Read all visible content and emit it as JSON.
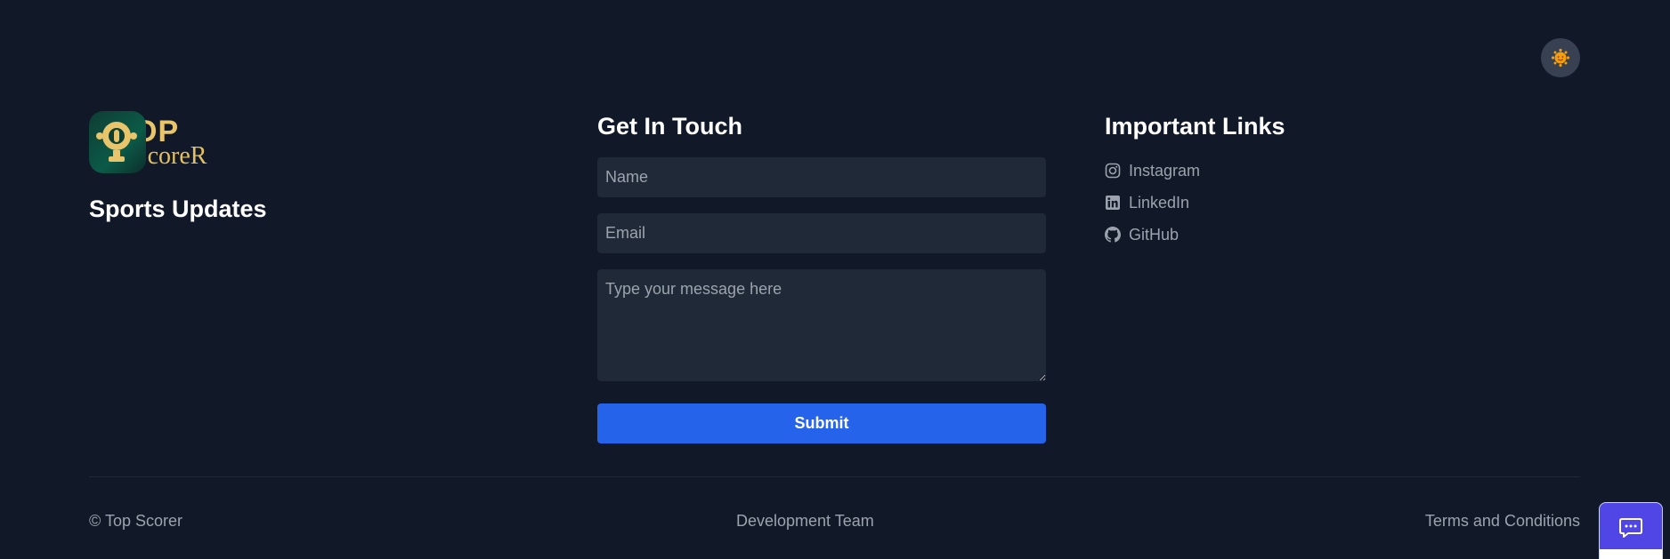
{
  "brand": {
    "logo_text_top": "OP",
    "logo_text_bottom": "ScoreR",
    "tagline": "Sports Updates"
  },
  "theme_toggle": {
    "icon": "sun-emoji-icon"
  },
  "contact": {
    "title": "Get In Touch",
    "name_placeholder": "Name",
    "email_placeholder": "Email",
    "message_placeholder": "Type your message here",
    "submit_label": "Submit"
  },
  "links": {
    "title": "Important Links",
    "items": [
      {
        "label": "Instagram",
        "icon": "instagram-icon"
      },
      {
        "label": "LinkedIn",
        "icon": "linkedin-icon"
      },
      {
        "label": "GitHub",
        "icon": "github-icon"
      }
    ]
  },
  "footer": {
    "copyright": "© Top Scorer",
    "dev_team": "Development Team",
    "terms": "Terms and Conditions"
  },
  "chat": {
    "icon": "chat-bubble-icon"
  },
  "colors": {
    "background": "#111827",
    "input_bg": "#1f2937",
    "primary": "#2563eb",
    "muted_text": "#9ca3af",
    "logo_gold": "#e8c46a",
    "chat_bg": "#4f46e5"
  }
}
